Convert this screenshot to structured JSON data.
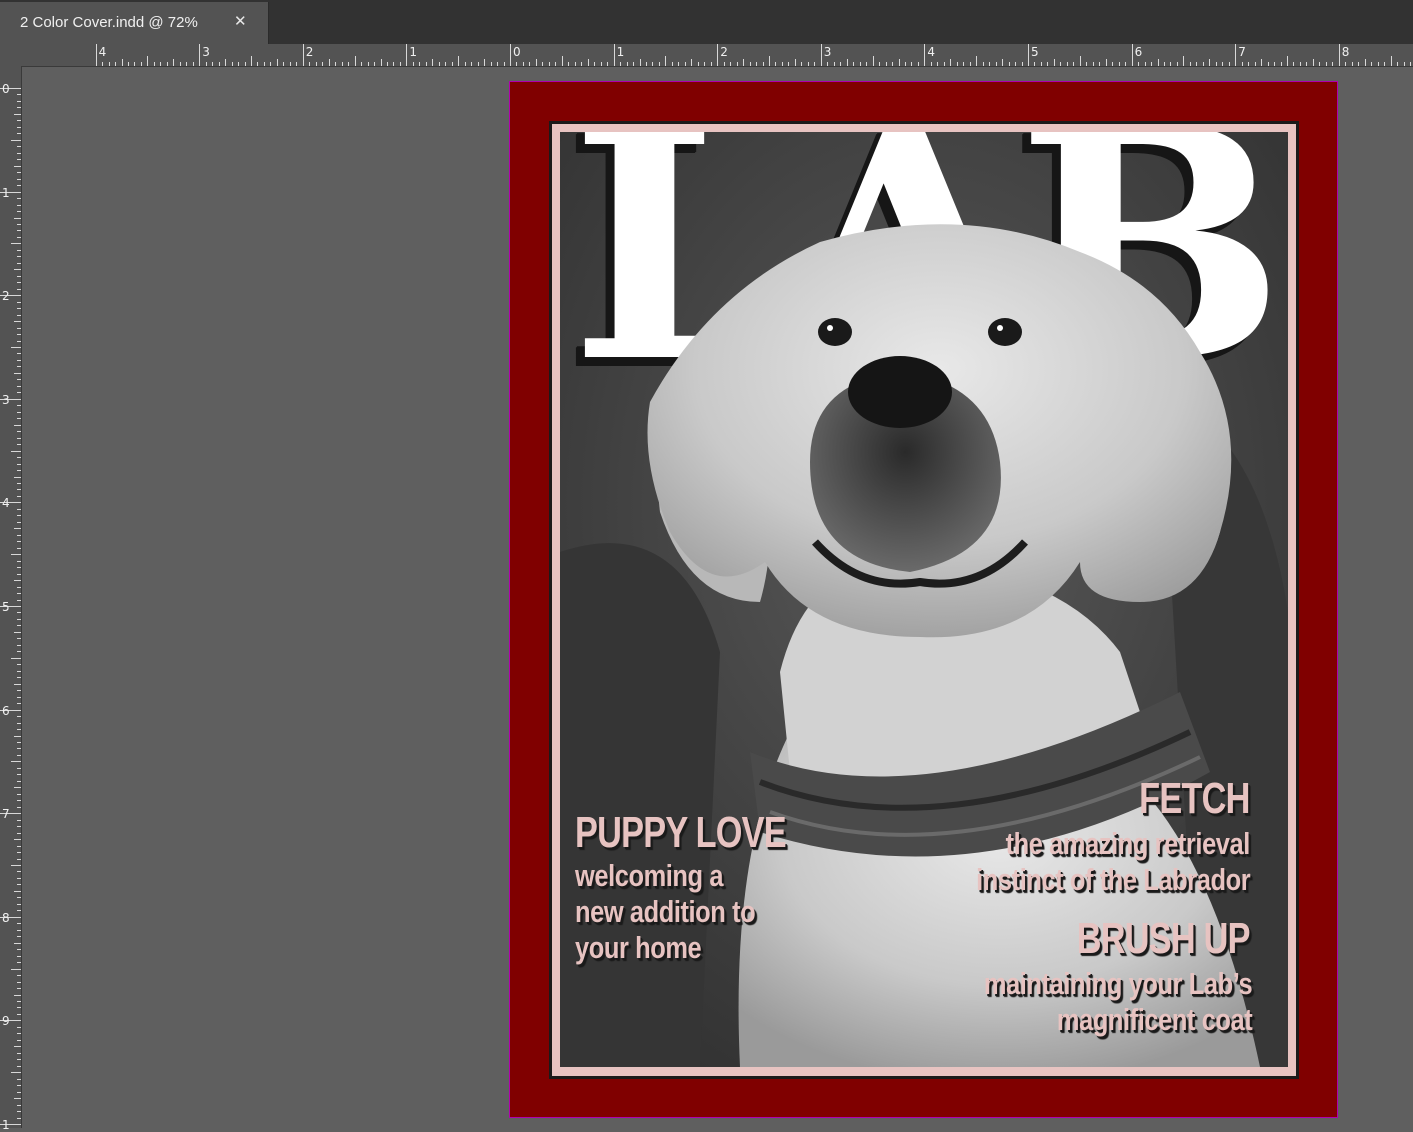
{
  "window": {
    "tab_title": "2 Color Cover.indd @ 72%",
    "close_glyph": "✕"
  },
  "rulers": {
    "horizontal_labels": [
      "4",
      "3",
      "2",
      "1",
      "0",
      "1",
      "2",
      "3",
      "4",
      "5",
      "6",
      "7",
      "8"
    ],
    "vertical_labels": [
      "0",
      "1",
      "2",
      "3",
      "4",
      "5",
      "6",
      "7",
      "8",
      "9",
      "1"
    ]
  },
  "cover": {
    "masthead": "LAB",
    "stories": {
      "puppy_love": {
        "headline": "PUPPY LOVE",
        "lines": [
          "welcoming a",
          "new addition to",
          "your home"
        ]
      },
      "fetch": {
        "headline": "FETCH",
        "lines": [
          "the amazing retrieval",
          "instinct of the Labrador"
        ]
      },
      "brush_up": {
        "headline": "BRUSH UP",
        "lines": [
          "maintaining your Lab’s",
          "magnificent coat"
        ]
      }
    },
    "colors": {
      "border": "#800000",
      "accent_pink": "#e7c3c1",
      "pasteboard": "#5f5f5f"
    }
  }
}
